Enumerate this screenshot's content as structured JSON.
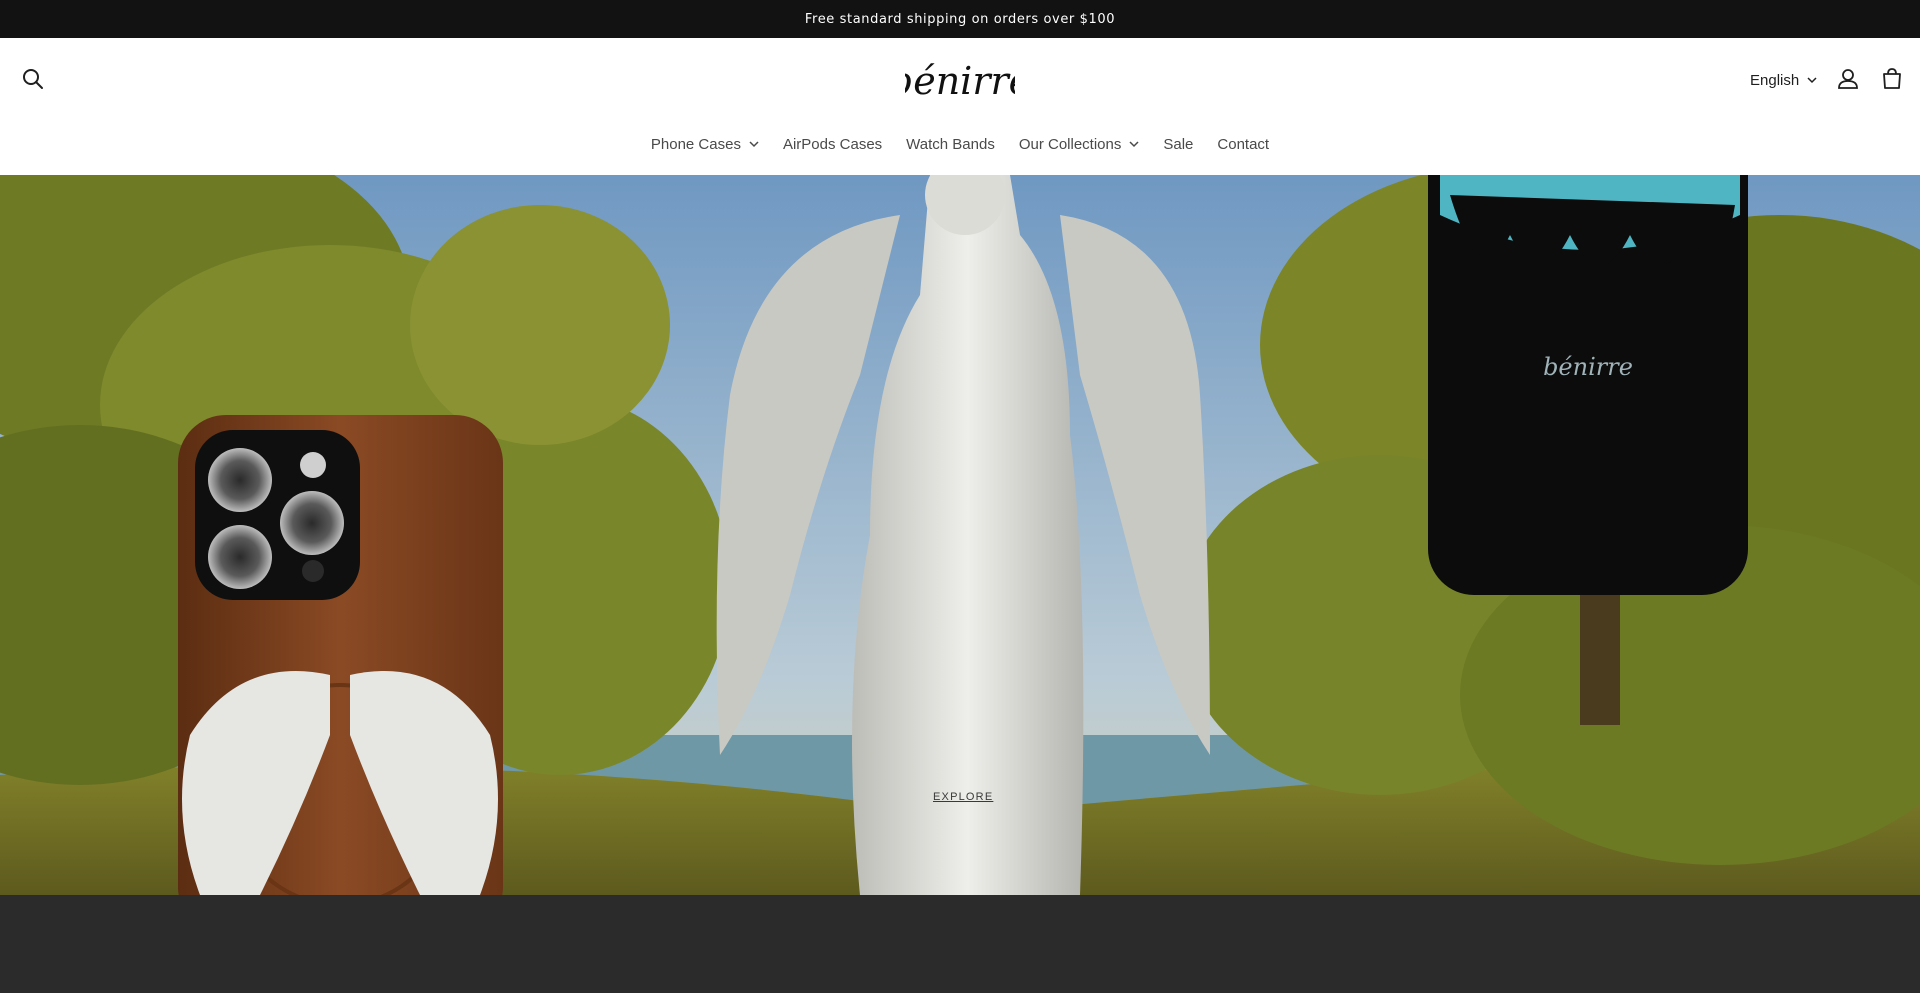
{
  "announcement": {
    "text": "Free standard shipping on orders over $100"
  },
  "header": {
    "logo_text": "bénirre",
    "language": "English",
    "icons": {
      "search": "search-icon",
      "account": "account-icon",
      "cart": "cart-icon"
    }
  },
  "nav": {
    "items": [
      {
        "label": "Phone Cases",
        "has_dropdown": true
      },
      {
        "label": "AirPods Cases",
        "has_dropdown": false
      },
      {
        "label": "Watch Bands",
        "has_dropdown": false
      },
      {
        "label": "Our Collections",
        "has_dropdown": true
      },
      {
        "label": "Sale",
        "has_dropdown": false
      },
      {
        "label": "Contact",
        "has_dropdown": false
      }
    ]
  },
  "hero": {
    "cta_label": "EXPLORE",
    "case_logo_text": "bénirre"
  },
  "colors": {
    "announcement_bg": "#121212",
    "header_bg": "#ffffff",
    "footer_bg": "#2b2b2b",
    "nav_text": "#4a4a4a",
    "brown_case": "#7a3f1e",
    "sky": "#8fb2cf",
    "foliage": "#7b8a2e"
  }
}
